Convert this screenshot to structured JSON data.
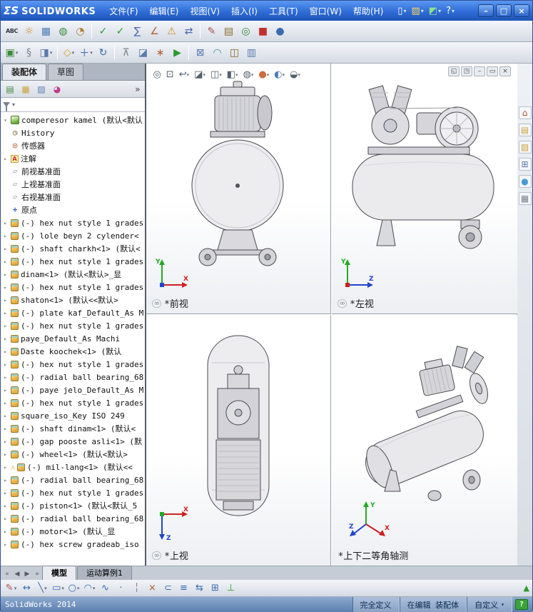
{
  "titlebar": {
    "logo_mark": "ΣS",
    "logo_text": "SOLIDWORKS",
    "menus": [
      {
        "name": "menu-file",
        "label": "文件(F)"
      },
      {
        "name": "menu-edit",
        "label": "编辑(E)"
      },
      {
        "name": "menu-view",
        "label": "视图(V)"
      },
      {
        "name": "menu-insert",
        "label": "插入(I)"
      },
      {
        "name": "menu-tools",
        "label": "工具(T)"
      },
      {
        "name": "menu-window",
        "label": "窗口(W)"
      },
      {
        "name": "menu-help",
        "label": "帮助(H)"
      }
    ],
    "quick_icons": [
      {
        "name": "new-document-icon",
        "glyph": "▯",
        "color": "#ffffff",
        "caret": true
      },
      {
        "name": "open-icon",
        "glyph": "▨",
        "color": "#ffd75e",
        "caret": true
      },
      {
        "name": "rebuild-icon",
        "glyph": "◩",
        "color": "#8fe08f",
        "caret": true
      },
      {
        "name": "help-icon",
        "glyph": "?",
        "color": "#ffffff",
        "caret": true
      }
    ],
    "window_controls": [
      {
        "name": "minimize-button",
        "glyph": "–"
      },
      {
        "name": "maximize-button",
        "glyph": "□"
      },
      {
        "name": "close-button",
        "glyph": "×"
      }
    ]
  },
  "toolbar_main": [
    {
      "name": "spelling-icon",
      "glyph": "ABC",
      "color": "#333a44",
      "text": true
    },
    {
      "name": "design-checker-icon",
      "glyph": "☼",
      "color": "#d09020"
    },
    {
      "name": "table-grid-icon",
      "glyph": "▦",
      "color": "#4a7ab5"
    },
    {
      "name": "publish-icon",
      "glyph": "◍",
      "color": "#3a8a3a"
    },
    {
      "name": "costing-icon",
      "glyph": "◔",
      "color": "#b08030"
    },
    {
      "sep": true
    },
    {
      "name": "check-read-icon",
      "glyph": "✓",
      "color": "#2a9a2a"
    },
    {
      "name": "check-doc-icon",
      "glyph": "✓",
      "color": "#2a9a2a"
    },
    {
      "name": "statistics-icon",
      "glyph": "∑",
      "color": "#4a6ab0"
    },
    {
      "name": "measure-icon",
      "glyph": "∠",
      "color": "#b06030"
    },
    {
      "name": "interference-icon",
      "glyph": "⚠",
      "color": "#d09020"
    },
    {
      "name": "compare-icon",
      "glyph": "⇄",
      "color": "#4a6ab0"
    },
    {
      "sep": true
    },
    {
      "name": "annotate-icon",
      "glyph": "✎",
      "color": "#b05050"
    },
    {
      "name": "design-table-icon",
      "glyph": "▤",
      "color": "#8a6a2a"
    },
    {
      "name": "verify-icon",
      "glyph": "◎",
      "color": "#3a8a3a"
    },
    {
      "name": "solid-cube-icon",
      "glyph": "■",
      "color": "#c03030"
    },
    {
      "name": "sphere-icon",
      "glyph": "●",
      "color": "#3a6ab0"
    }
  ],
  "toolbar_assembly": [
    {
      "name": "insert-component-icon",
      "glyph": "▣",
      "color": "#3a8a3a",
      "caret": true
    },
    {
      "name": "paperclip-icon",
      "glyph": "§",
      "color": "#7a828c"
    },
    {
      "name": "hidden-components-icon",
      "glyph": "◨",
      "color": "#5a7ab0",
      "caret": true
    },
    {
      "sep": true
    },
    {
      "name": "mate-icon",
      "glyph": "◇",
      "color": "#d0a020",
      "caret": true
    },
    {
      "name": "move-component-icon",
      "glyph": "＋",
      "color": "#3a6ab0",
      "caret": true
    },
    {
      "name": "rotate-component-icon",
      "glyph": "↻",
      "color": "#3a6ab0"
    },
    {
      "sep": true
    },
    {
      "name": "smart-fasteners-icon",
      "glyph": "⊼",
      "color": "#7a828c"
    },
    {
      "name": "assembly-features-icon",
      "glyph": "◪",
      "color": "#5a7ab0"
    },
    {
      "name": "exploded-view-icon",
      "glyph": "∗",
      "color": "#b06030"
    },
    {
      "name": "simulation-icon",
      "glyph": "▶",
      "color": "#2a9a2a"
    },
    {
      "sep": true
    },
    {
      "name": "interference-check-icon",
      "glyph": "⊠",
      "color": "#5a7ab0"
    },
    {
      "name": "curvature-icon",
      "glyph": "◠",
      "color": "#3a8a8a"
    },
    {
      "name": "snapshot-icon",
      "glyph": "◫",
      "color": "#8a6a2a"
    },
    {
      "name": "photo-view-icon",
      "glyph": "▥",
      "color": "#5a7ab0"
    }
  ],
  "doc_tabs": [
    {
      "name": "tab-assembly",
      "label": "装配体",
      "active": true
    },
    {
      "name": "tab-sketch",
      "label": "草图",
      "active": false
    }
  ],
  "panel_tabs": [
    {
      "name": "featuremanager-tab-icon",
      "glyph": "▤",
      "color": "#3a8a3a"
    },
    {
      "name": "propertymanager-tab-icon",
      "glyph": "▦",
      "color": "#caa53a"
    },
    {
      "name": "configurations-tab-icon",
      "glyph": "▨",
      "color": "#5a7ab0"
    },
    {
      "name": "dimxpert-tab-icon",
      "glyph": "◕",
      "color": "#c03a8a"
    }
  ],
  "panel_expand_glyph": "»",
  "filter": {
    "value": ""
  },
  "tree": {
    "icon_glyphs": {
      "history": "◷",
      "sensors": "◎",
      "annotations": "A",
      "plane": "▱",
      "origin": "+"
    },
    "root": {
      "text": "comperesor kamel (默认<默认"
    },
    "items": [
      {
        "icon": "history",
        "text": "History"
      },
      {
        "icon": "sensors",
        "text": "传感器"
      },
      {
        "icon": "annotations",
        "text": "注解",
        "expand": true
      },
      {
        "icon": "plane",
        "text": "前视基准面"
      },
      {
        "icon": "plane",
        "text": "上视基准面"
      },
      {
        "icon": "plane",
        "text": "右视基准面"
      },
      {
        "icon": "origin",
        "text": "原点"
      },
      {
        "icon": "part",
        "expand": true,
        "text": "(-) hex nut style 1 grades"
      },
      {
        "icon": "part",
        "expand": true,
        "text": "(-) lole beyn 2 cylender<"
      },
      {
        "icon": "part",
        "expand": true,
        "text": "(-) shaft charkh<1> (默认<"
      },
      {
        "icon": "part",
        "expand": true,
        "text": "(-) hex nut style 1 grades"
      },
      {
        "icon": "part",
        "expand": true,
        "text": "dinam<1> (默认<默认>_显"
      },
      {
        "icon": "part",
        "expand": true,
        "text": "(-) hex nut style 1 grades"
      },
      {
        "icon": "part",
        "expand": true,
        "text": "shaton<1> (默认<<默认>"
      },
      {
        "icon": "part",
        "expand": true,
        "text": "(-) plate kaf_Default_As M"
      },
      {
        "icon": "part",
        "expand": true,
        "text": "(-) hex nut style 1 grades"
      },
      {
        "icon": "part",
        "expand": true,
        "text": "paye_Default_As Machi"
      },
      {
        "icon": "part",
        "expand": true,
        "text": "Daste koochek<1> (默认"
      },
      {
        "icon": "part",
        "expand": true,
        "text": "(-) hex nut style 1 grades"
      },
      {
        "icon": "part",
        "expand": true,
        "text": "(-) radial ball bearing_68"
      },
      {
        "icon": "part",
        "expand": true,
        "text": "(-) paye jelo_Default_As M"
      },
      {
        "icon": "part",
        "expand": true,
        "text": "(-) hex nut style 1 grades"
      },
      {
        "icon": "part",
        "expand": true,
        "text": "square_iso_Key ISO 249"
      },
      {
        "icon": "part",
        "expand": true,
        "text": "(-) shaft dinam<1> (默认<"
      },
      {
        "icon": "part",
        "expand": true,
        "text": "(-) gap pooste asli<1> (默"
      },
      {
        "icon": "part",
        "expand": true,
        "text": "(-) wheel<1> (默认<默认>"
      },
      {
        "icon": "part",
        "expand": true,
        "warning": true,
        "text": "(-) mil-lang<1> (默认<<"
      },
      {
        "icon": "part",
        "expand": true,
        "text": "(-) radial ball bearing_68"
      },
      {
        "icon": "part",
        "expand": true,
        "text": "(-) hex nut style 1 grades"
      },
      {
        "icon": "part",
        "expand": true,
        "text": "(-) piston<1> (默认<默认_5"
      },
      {
        "icon": "part",
        "expand": true,
        "text": "(-) radial ball bearing_68"
      },
      {
        "icon": "part",
        "expand": true,
        "text": "(-) motor<1> (默认_显"
      },
      {
        "icon": "part",
        "expand": true,
        "text": "(-) hex screw gradeab_iso"
      }
    ]
  },
  "viewport_toolbar": [
    {
      "name": "zoom-fit-icon",
      "glyph": "◎"
    },
    {
      "name": "zoom-area-icon",
      "glyph": "⊡"
    },
    {
      "name": "previous-view-icon",
      "glyph": "↩",
      "caret": true
    },
    {
      "name": "section-view-icon",
      "glyph": "◪",
      "caret": true
    },
    {
      "name": "view-orientation-icon",
      "glyph": "◫",
      "caret": true
    },
    {
      "name": "display-style-icon",
      "glyph": "◧",
      "caret": true
    },
    {
      "name": "hide-show-icon",
      "glyph": "◍",
      "caret": true
    },
    {
      "name": "edit-appearance-icon",
      "glyph": "●",
      "color": "#cf6a3c",
      "caret": true
    },
    {
      "name": "apply-scene-icon",
      "glyph": "◐",
      "color": "#4a78b8",
      "caret": true
    },
    {
      "name": "view-settings-icon",
      "glyph": "◒",
      "caret": true
    }
  ],
  "doc_controls": [
    {
      "name": "restore-left-icon",
      "glyph": "◱"
    },
    {
      "name": "restore-right-icon",
      "glyph": "◳"
    },
    {
      "name": "minimize-doc-icon",
      "glyph": "–"
    },
    {
      "name": "restore-doc-icon",
      "glyph": "▭"
    },
    {
      "name": "close-doc-icon",
      "glyph": "×"
    }
  ],
  "viewports": [
    {
      "label": "*前视"
    },
    {
      "label": "*左视"
    },
    {
      "label": "*上视"
    },
    {
      "label": "*上下二等角轴测"
    }
  ],
  "axis_labels": {
    "x": "X",
    "y": "Y",
    "z": "Z"
  },
  "right_rail": [
    {
      "name": "resources-home-icon",
      "glyph": "⌂",
      "color": "#b05030"
    },
    {
      "name": "design-library-icon",
      "glyph": "▤",
      "color": "#caa53a"
    },
    {
      "name": "file-explorer-icon",
      "glyph": "▨",
      "color": "#caa53a"
    },
    {
      "name": "view-palette-icon",
      "glyph": "⊞",
      "color": "#5a7ab0"
    },
    {
      "name": "appearances-icon",
      "glyph": "●",
      "color": "#4a9ad0"
    },
    {
      "name": "custom-properties-icon",
      "glyph": "▦",
      "color": "#7a828c"
    }
  ],
  "bottom_nav": [
    {
      "name": "first-tab-button",
      "glyph": "«"
    },
    {
      "name": "prev-tab-button",
      "glyph": "◀"
    },
    {
      "name": "next-tab-button",
      "glyph": "▶"
    },
    {
      "name": "last-tab-button",
      "glyph": "»"
    }
  ],
  "model_tabs": [
    {
      "name": "tab-model",
      "label": "模型",
      "active": true
    },
    {
      "name": "tab-motion-study",
      "label": "运动算例1",
      "active": false
    }
  ],
  "sketch_toolbar": [
    {
      "name": "sketch-icon",
      "glyph": "✎",
      "color": "#b05050",
      "caret": true
    },
    {
      "name": "smart-dimension-icon",
      "glyph": "↔",
      "color": "#3a6ab0"
    },
    {
      "name": "line-icon",
      "glyph": "╲",
      "color": "#3a6ab0",
      "caret": true
    },
    {
      "name": "rectangle-icon",
      "glyph": "▭",
      "color": "#3a6ab0",
      "caret": true
    },
    {
      "name": "circle-icon",
      "glyph": "○",
      "color": "#3a6ab0",
      "caret": true
    },
    {
      "name": "arc-icon",
      "glyph": "◠",
      "color": "#3a6ab0",
      "caret": true
    },
    {
      "name": "spline-icon",
      "glyph": "∿",
      "color": "#3a6ab0"
    },
    {
      "name": "point-icon",
      "glyph": "·",
      "color": "#3a6ab0"
    },
    {
      "name": "centerline-icon",
      "glyph": "╎",
      "color": "#7a828c"
    },
    {
      "name": "trim-icon",
      "glyph": "×",
      "color": "#b06030"
    },
    {
      "name": "convert-entities-icon",
      "glyph": "⊂",
      "color": "#3a6ab0"
    },
    {
      "name": "offset-entities-icon",
      "glyph": "≡",
      "color": "#3a6ab0"
    },
    {
      "name": "mirror-entities-icon",
      "glyph": "⇆",
      "color": "#3a6ab0"
    },
    {
      "name": "pattern-icon",
      "glyph": "⊞",
      "color": "#3a6ab0"
    },
    {
      "name": "display-relations-icon",
      "glyph": "⊥",
      "color": "#2a9a2a"
    }
  ],
  "statusbar": {
    "app_name": "SolidWorks 2014",
    "segments": [
      {
        "name": "definition-status",
        "text": "完全定义"
      },
      {
        "name": "edit-status",
        "text": "在编辑 装配体"
      },
      {
        "name": "units-status",
        "text": "自定义",
        "caret": true
      }
    ],
    "help_glyph": "?"
  }
}
